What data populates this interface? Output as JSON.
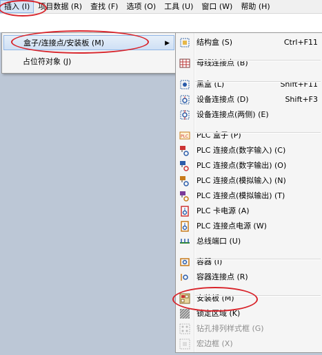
{
  "menubar": [
    {
      "label": "插入 (I)",
      "active": true
    },
    {
      "label": "项目数据 (R)"
    },
    {
      "label": "查找 (F)"
    },
    {
      "label": "选项 (O)"
    },
    {
      "label": "工具 (U)"
    },
    {
      "label": "窗口 (W)"
    },
    {
      "label": "帮助 (H)"
    }
  ],
  "insert_menu": [
    {
      "label": "盒子/连接点/安装板 (M)",
      "submenu": true,
      "highlighted": true
    },
    {
      "label": "占位符对象 (J)"
    }
  ],
  "submenu": [
    {
      "label": "结构盒 (S)",
      "shortcut": "Ctrl+F11",
      "icon": "structure-box-icon"
    },
    {
      "label": "母线连接点 (B)",
      "shortcut": "",
      "icon": "busbar-connection-icon"
    },
    {
      "label": "黑盒 (L)",
      "shortcut": "Shift+F11",
      "icon": "black-box-icon"
    },
    {
      "label": "设备连接点 (D)",
      "shortcut": "Shift+F3",
      "icon": "device-connection-icon"
    },
    {
      "label": "设备连接点(两侧) (E)",
      "shortcut": "",
      "icon": "device-connection-both-icon"
    },
    {
      "label": "PLC 盒子 (P)",
      "shortcut": "",
      "icon": "plc-box-icon"
    },
    {
      "label": "PLC 连接点(数字输入) (C)",
      "shortcut": "",
      "icon": "plc-digital-input-icon"
    },
    {
      "label": "PLC 连接点(数字输出) (O)",
      "shortcut": "",
      "icon": "plc-digital-output-icon"
    },
    {
      "label": "PLC 连接点(模拟输入) (N)",
      "shortcut": "",
      "icon": "plc-analog-input-icon"
    },
    {
      "label": "PLC 连接点(模拟输出) (T)",
      "shortcut": "",
      "icon": "plc-analog-output-icon"
    },
    {
      "label": "PLC 卡电源 (A)",
      "shortcut": "",
      "icon": "plc-card-power-icon"
    },
    {
      "label": "PLC 连接点电源 (W)",
      "shortcut": "",
      "icon": "plc-connection-power-icon"
    },
    {
      "label": "总线端口 (U)",
      "shortcut": "",
      "icon": "bus-port-icon"
    },
    {
      "label": "容器 (I)",
      "shortcut": "",
      "icon": "container-icon"
    },
    {
      "label": "容器连接点 (R)",
      "shortcut": "",
      "icon": "container-connection-icon"
    },
    {
      "label": "安装板 (M)",
      "shortcut": "",
      "icon": "mounting-panel-icon"
    },
    {
      "label": "锁定区域 (K)",
      "shortcut": "",
      "icon": "locked-area-icon"
    },
    {
      "label": "钻孔排列样式框 (G)",
      "shortcut": "",
      "icon": "drill-pattern-icon",
      "disabled": true
    },
    {
      "label": "宏边框 (X)",
      "shortcut": "",
      "icon": "macro-border-icon",
      "disabled": true
    }
  ]
}
